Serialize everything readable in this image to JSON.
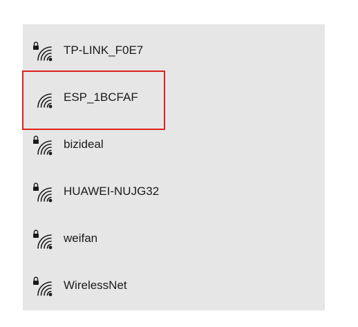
{
  "wifi_list": {
    "networks": [
      {
        "ssid": "TP-LINK_F0E7",
        "secured": true,
        "icon": "wifi-secured-icon"
      },
      {
        "ssid": "ESP_1BCFAF",
        "secured": false,
        "icon": "wifi-open-icon"
      },
      {
        "ssid": "bizideal",
        "secured": true,
        "icon": "wifi-secured-icon"
      },
      {
        "ssid": "HUAWEI-NUJG32",
        "secured": true,
        "icon": "wifi-secured-icon"
      },
      {
        "ssid": "weifan",
        "secured": true,
        "icon": "wifi-secured-icon"
      },
      {
        "ssid": "WirelessNet",
        "secured": true,
        "icon": "wifi-secured-icon"
      }
    ],
    "highlighted_ssid": "ESP_1BCFAF"
  },
  "colors": {
    "panel_background": "#e6e6e6",
    "highlight_border": "#e0201a",
    "text": "#1a1a1a",
    "icon": "#1a1a1a"
  }
}
